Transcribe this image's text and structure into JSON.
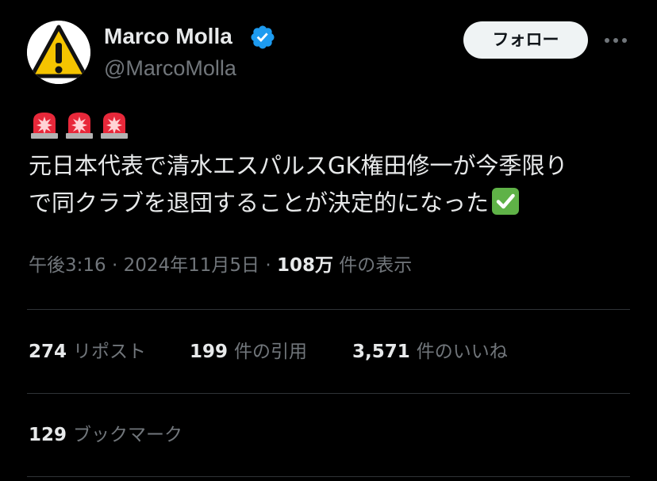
{
  "author": {
    "display_name": "Marco Molla",
    "handle": "@MarcoMolla",
    "avatar_icon": "warning-sign-icon",
    "verified_icon": "verified-badge-icon",
    "verified_color": "#1d9bf0"
  },
  "actions": {
    "follow_label": "フォロー",
    "more_icon": "more-dots-icon"
  },
  "tweet": {
    "leading_emoji": [
      "rotating-light-icon",
      "rotating-light-icon",
      "rotating-light-icon"
    ],
    "text_line_1": "元日本代表で清水エスパルスGK権田修一が今季限り",
    "text_line_2": "で同クラブを退団することが決定的になった",
    "trailing_emoji": "check-mark-button-icon"
  },
  "meta": {
    "time": "午後3:16",
    "separator": "·",
    "date": "2024年11月5日",
    "views_count": "108万",
    "views_label": "件の表示"
  },
  "stats": {
    "reposts_count": "274",
    "reposts_label": "リポスト",
    "quotes_count": "199",
    "quotes_label": "件の引用",
    "likes_count": "3,571",
    "likes_label": "件のいいね",
    "bookmarks_count": "129",
    "bookmarks_label": "ブックマーク"
  },
  "colors": {
    "background": "#000000",
    "primary_text": "#e7e9ea",
    "secondary_text": "#71767b",
    "divider": "#2f3336",
    "follow_button_bg": "#eff3f4"
  }
}
